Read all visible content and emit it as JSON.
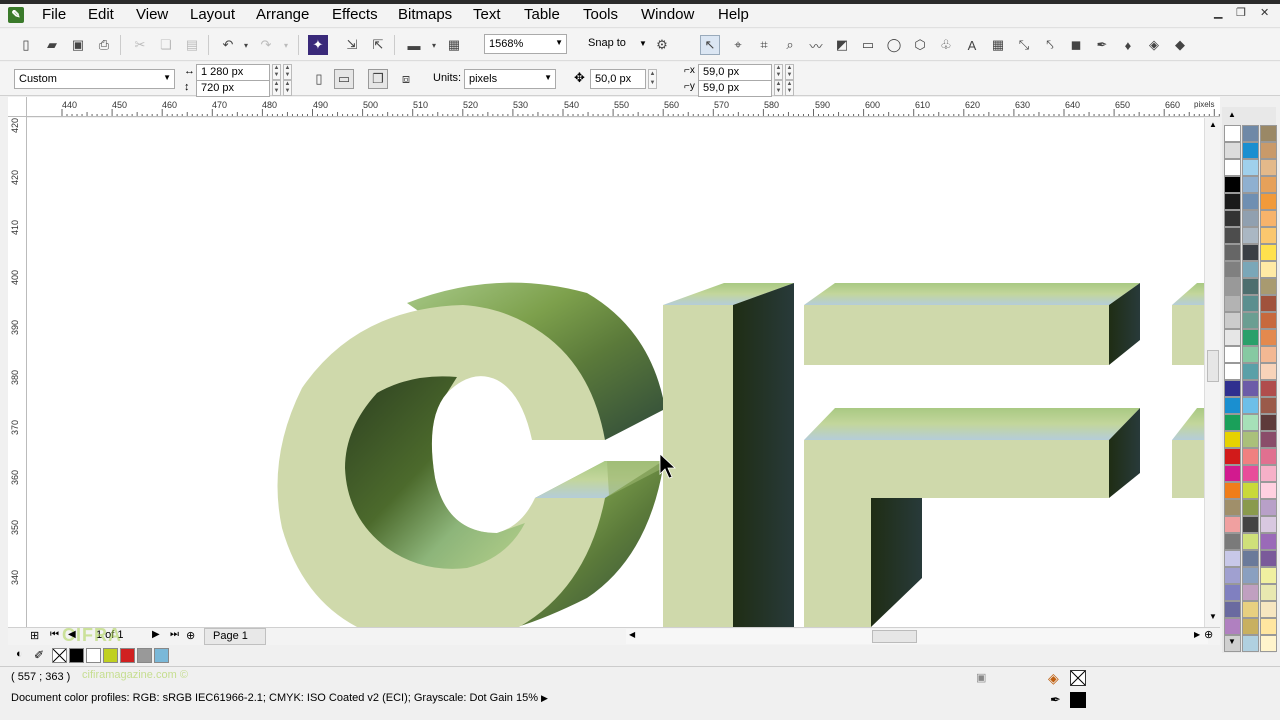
{
  "menubar": {
    "items": [
      "File",
      "Edit",
      "View",
      "Layout",
      "Arrange",
      "Effects",
      "Bitmaps",
      "Text",
      "Table",
      "Tools",
      "Window",
      "Help"
    ]
  },
  "toolbar": {
    "zoom": "1568%",
    "snap_label": "Snap to"
  },
  "property_bar": {
    "preset": "Custom",
    "width": "1 280 px",
    "height": "720 px",
    "units_label": "Units:",
    "units_value": "pixels",
    "nudge": "50,0 px",
    "dup_x": "59,0 px",
    "dup_y": "59,0 px"
  },
  "rulers": {
    "horizontal": [
      "440",
      "450",
      "460",
      "470",
      "480",
      "490",
      "500",
      "510",
      "520",
      "530",
      "540",
      "550",
      "560",
      "570",
      "580",
      "590",
      "600",
      "610",
      "620",
      "630",
      "640",
      "650",
      "660"
    ],
    "unit": "pixels",
    "vertical": [
      "420",
      "410",
      "400",
      "390",
      "380",
      "370",
      "360",
      "350",
      "340"
    ]
  },
  "page_nav": {
    "page_count": "1 of 1",
    "page_tab": "Page 1"
  },
  "status": {
    "coordinates": "( 557  ; 363 )",
    "color_profiles": "Document color profiles: RGB: sRGB IEC61966-2.1; CMYK: ISO Coated v2 (ECI); Grayscale: Dot Gain 15%"
  },
  "watermark": {
    "logo_text": "CIFRA",
    "site": "cifiramagazine.com"
  },
  "colors": {
    "face": "#cfd9ab",
    "shadow_dark": "#22301e",
    "accent_green": "#7fb52e"
  },
  "palette": [
    [
      "#ffffff",
      "#6f89a7",
      "#9a8866"
    ],
    [
      "#dcdcdc",
      "#1a8fd0",
      "#c99a6a"
    ],
    [
      "#ffffff",
      "#9fd0ec",
      "#e3b98a"
    ],
    [
      "#000000",
      "#8fb0d0",
      "#e6a15a"
    ],
    [
      "#1a1a1a",
      "#6f8fb2",
      "#f19a3a"
    ],
    [
      "#333333",
      "#90a0b0",
      "#f7b36b"
    ],
    [
      "#4d4d4d",
      "#aab7c3",
      "#fac76e"
    ],
    [
      "#666666",
      "#3a3f45",
      "#ffe14d"
    ],
    [
      "#808080",
      "#7aa7b8",
      "#ffeaa5"
    ],
    [
      "#999999",
      "#4d6e6e",
      "#a89a70"
    ],
    [
      "#b3b3b3",
      "#5b8f8f",
      "#a0523c"
    ],
    [
      "#cccccc",
      "#6a9e92",
      "#c7693d"
    ],
    [
      "#e6e6e6",
      "#2aa06a",
      "#e3894e"
    ],
    [
      "#ffffff",
      "#86c9a2",
      "#f3b893"
    ],
    [
      "#ffffff",
      "#5aa0a8",
      "#f8d3b9"
    ],
    [
      "#2f2f8f",
      "#6c5ca8",
      "#b04d4d"
    ],
    [
      "#1a8fd0",
      "#6dbfe8",
      "#9a5a4a"
    ],
    [
      "#1aa05a",
      "#a6e0b8",
      "#5e3a3a"
    ],
    [
      "#e6d200",
      "#aac07a",
      "#8a4d6a"
    ],
    [
      "#d21a1a",
      "#f08080",
      "#e07090"
    ],
    [
      "#d21a8f",
      "#e84d9a",
      "#f6b0c8"
    ],
    [
      "#f07d1a",
      "#c9d93a",
      "#ffd0e0"
    ],
    [
      "#a08f6a",
      "#8a9a4d",
      "#b8a0c8"
    ],
    [
      "#f0a0a0",
      "#444444",
      "#d8c8e0"
    ],
    [
      "#7a7a7a",
      "#cfe07a",
      "#9a6ab8"
    ],
    [
      "#c8c8e8",
      "#6a7a9a",
      "#7a5a9a"
    ],
    [
      "#a0a0d0",
      "#8aa0c0",
      "#f0f0a0"
    ],
    [
      "#8080c0",
      "#c0a0c0",
      "#e8e8b0"
    ],
    [
      "#6a6aa0",
      "#e8d080",
      "#f6e6c0"
    ],
    [
      "#b080c0",
      "#c8b060",
      "#ffe6a0"
    ],
    [
      "#d0d0d0",
      "#b0d0e0",
      "#fff4cc"
    ]
  ]
}
